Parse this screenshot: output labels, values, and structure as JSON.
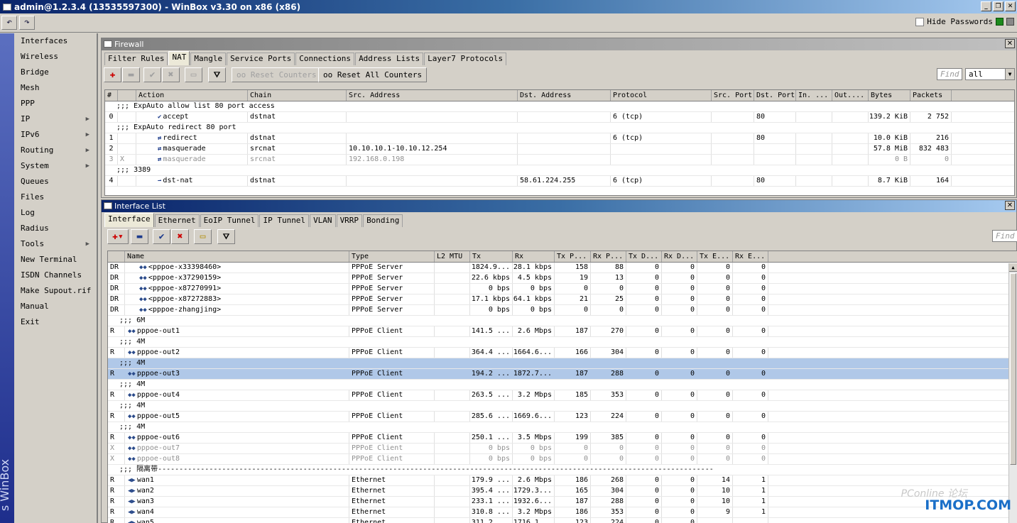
{
  "window": {
    "title": "admin@1.2.3.4 (13535597300) - WinBox v3.30 on x86 (x86)",
    "btns": [
      "_",
      "❐",
      "✕"
    ]
  },
  "toolbar": {
    "undo_icon": "undo-icon",
    "redo_icon": "redo-icon",
    "hide_passwords_label": "Hide Passwords"
  },
  "brand": "s WinBox",
  "menu": [
    {
      "label": "Interfaces",
      "sub": false
    },
    {
      "label": "Wireless",
      "sub": false
    },
    {
      "label": "Bridge",
      "sub": false
    },
    {
      "label": "Mesh",
      "sub": false
    },
    {
      "label": "PPP",
      "sub": false
    },
    {
      "label": "IP",
      "sub": true
    },
    {
      "label": "IPv6",
      "sub": true
    },
    {
      "label": "Routing",
      "sub": true
    },
    {
      "label": "System",
      "sub": true
    },
    {
      "label": "Queues",
      "sub": false
    },
    {
      "label": "Files",
      "sub": false
    },
    {
      "label": "Log",
      "sub": false
    },
    {
      "label": "Radius",
      "sub": false
    },
    {
      "label": "Tools",
      "sub": true
    },
    {
      "label": "New Terminal",
      "sub": false
    },
    {
      "label": "ISDN Channels",
      "sub": false
    },
    {
      "label": "Make Supout.rif",
      "sub": false
    },
    {
      "label": "Manual",
      "sub": false
    },
    {
      "label": "Exit",
      "sub": false
    }
  ],
  "firewall": {
    "title": "Firewall",
    "tabs": [
      "Filter Rules",
      "NAT",
      "Mangle",
      "Service Ports",
      "Connections",
      "Address Lists",
      "Layer7 Protocols"
    ],
    "selected_tab": "NAT",
    "reset_counters": "Reset Counters",
    "reset_all_counters": "Reset All Counters",
    "find_placeholder": "Find",
    "filter_value": "all",
    "columns": [
      "#",
      "",
      "Action",
      "Chain",
      "Src. Address",
      "Dst. Address",
      "Protocol",
      "Src. Port",
      "Dst. Port",
      "In. ...",
      "Out....",
      "Bytes",
      "Packets"
    ],
    "rows": [
      {
        "type": "comment",
        "text": ";;; ExpAuto allow list 80 port access"
      },
      {
        "type": "row",
        "num": "0",
        "flag": "",
        "icon": "✔",
        "action": "accept",
        "chain": "dstnat",
        "src": "",
        "dst": "",
        "proto": "6 (tcp)",
        "sport": "",
        "dport": "80",
        "in": "",
        "out": "",
        "bytes": "139.2 KiB",
        "packets": "2 752"
      },
      {
        "type": "comment",
        "text": ";;; ExpAuto redirect 80 port"
      },
      {
        "type": "row",
        "num": "1",
        "flag": "",
        "icon": "⇄",
        "action": "redirect",
        "chain": "dstnat",
        "src": "",
        "dst": "",
        "proto": "6 (tcp)",
        "sport": "",
        "dport": "80",
        "in": "",
        "out": "",
        "bytes": "10.0 KiB",
        "packets": "216"
      },
      {
        "type": "row",
        "num": "2",
        "flag": "",
        "icon": "⇄",
        "action": "masquerade",
        "chain": "srcnat",
        "src": "10.10.10.1-10.10.12.254",
        "dst": "",
        "proto": "",
        "sport": "",
        "dport": "",
        "in": "",
        "out": "",
        "bytes": "57.8 MiB",
        "packets": "832 483"
      },
      {
        "type": "row",
        "disabled": true,
        "num": "3",
        "flag": "X",
        "icon": "⇄",
        "action": "masquerade",
        "chain": "srcnat",
        "src": "192.168.0.198",
        "dst": "",
        "proto": "",
        "sport": "",
        "dport": "",
        "in": "",
        "out": "",
        "bytes": "0 B",
        "packets": "0"
      },
      {
        "type": "comment",
        "text": ";;; 3389"
      },
      {
        "type": "row",
        "num": "4",
        "flag": "",
        "icon": "⇀",
        "action": "dst-nat",
        "chain": "dstnat",
        "src": "",
        "dst": "58.61.224.255",
        "proto": "6 (tcp)",
        "sport": "",
        "dport": "80",
        "in": "",
        "out": "",
        "bytes": "8.7 KiB",
        "packets": "164"
      }
    ]
  },
  "interfaces": {
    "title": "Interface List",
    "tabs": [
      "Interface",
      "Ethernet",
      "EoIP Tunnel",
      "IP Tunnel",
      "VLAN",
      "VRRP",
      "Bonding"
    ],
    "selected_tab": "Interface",
    "find_placeholder": "Find",
    "columns": [
      "",
      "Name",
      "Type",
      "L2 MTU",
      "Tx",
      "Rx",
      "Tx P...",
      "Rx P...",
      "Tx D...",
      "Rx D...",
      "Tx E...",
      "Rx E..."
    ],
    "rows": [
      {
        "type": "row",
        "flag": "DR",
        "name": "<pppoe-x33398460>",
        "itype": "PPPoE Server",
        "mtu": "",
        "tx": "1824.9...",
        "rx": "28.1 kbps",
        "txp": "158",
        "rxp": "88",
        "txd": "0",
        "rxd": "0",
        "txe": "0",
        "rxe": "0",
        "indent": true
      },
      {
        "type": "row",
        "flag": "DR",
        "name": "<pppoe-x37290159>",
        "itype": "PPPoE Server",
        "mtu": "",
        "tx": "22.6 kbps",
        "rx": "4.5 kbps",
        "txp": "19",
        "rxp": "13",
        "txd": "0",
        "rxd": "0",
        "txe": "0",
        "rxe": "0",
        "indent": true
      },
      {
        "type": "row",
        "flag": "DR",
        "name": "<pppoe-x87270991>",
        "itype": "PPPoE Server",
        "mtu": "",
        "tx": "0 bps",
        "rx": "0 bps",
        "txp": "0",
        "rxp": "0",
        "txd": "0",
        "rxd": "0",
        "txe": "0",
        "rxe": "0",
        "indent": true
      },
      {
        "type": "row",
        "flag": "DR",
        "name": "<pppoe-x87272883>",
        "itype": "PPPoE Server",
        "mtu": "",
        "tx": "17.1 kbps",
        "rx": "64.1 kbps",
        "txp": "21",
        "rxp": "25",
        "txd": "0",
        "rxd": "0",
        "txe": "0",
        "rxe": "0",
        "indent": true
      },
      {
        "type": "row",
        "flag": "DR",
        "name": "<pppoe-zhangjing>",
        "itype": "PPPoE Server",
        "mtu": "",
        "tx": "0 bps",
        "rx": "0 bps",
        "txp": "0",
        "rxp": "0",
        "txd": "0",
        "rxd": "0",
        "txe": "0",
        "rxe": "0",
        "indent": true
      },
      {
        "type": "comment",
        "text": ";;; 6M"
      },
      {
        "type": "row",
        "flag": "R",
        "name": "pppoe-out1",
        "itype": "PPPoE Client",
        "mtu": "",
        "tx": "141.5 ...",
        "rx": "2.6 Mbps",
        "txp": "187",
        "rxp": "270",
        "txd": "0",
        "rxd": "0",
        "txe": "0",
        "rxe": "0"
      },
      {
        "type": "comment",
        "text": ";;; 4M"
      },
      {
        "type": "row",
        "flag": "R",
        "name": "pppoe-out2",
        "itype": "PPPoE Client",
        "mtu": "",
        "tx": "364.4 ...",
        "rx": "1664.6...",
        "txp": "166",
        "rxp": "304",
        "txd": "0",
        "rxd": "0",
        "txe": "0",
        "rxe": "0"
      },
      {
        "type": "comment",
        "selected": true,
        "text": ";;; 4M"
      },
      {
        "type": "row",
        "selected": true,
        "flag": "R",
        "name": "pppoe-out3",
        "itype": "PPPoE Client",
        "mtu": "",
        "tx": "194.2 ...",
        "rx": "1872.7...",
        "txp": "187",
        "rxp": "288",
        "txd": "0",
        "rxd": "0",
        "txe": "0",
        "rxe": "0"
      },
      {
        "type": "comment",
        "text": ";;; 4M"
      },
      {
        "type": "row",
        "flag": "R",
        "name": "pppoe-out4",
        "itype": "PPPoE Client",
        "mtu": "",
        "tx": "263.5 ...",
        "rx": "3.2 Mbps",
        "txp": "185",
        "rxp": "353",
        "txd": "0",
        "rxd": "0",
        "txe": "0",
        "rxe": "0"
      },
      {
        "type": "comment",
        "text": ";;; 4M"
      },
      {
        "type": "row",
        "flag": "R",
        "name": "pppoe-out5",
        "itype": "PPPoE Client",
        "mtu": "",
        "tx": "285.6 ...",
        "rx": "1669.6...",
        "txp": "123",
        "rxp": "224",
        "txd": "0",
        "rxd": "0",
        "txe": "0",
        "rxe": "0"
      },
      {
        "type": "comment",
        "text": ";;; 4M"
      },
      {
        "type": "row",
        "flag": "R",
        "name": "pppoe-out6",
        "itype": "PPPoE Client",
        "mtu": "",
        "tx": "250.1 ...",
        "rx": "3.5 Mbps",
        "txp": "199",
        "rxp": "385",
        "txd": "0",
        "rxd": "0",
        "txe": "0",
        "rxe": "0"
      },
      {
        "type": "row",
        "disabled": true,
        "flag": "X",
        "name": "pppoe-out7",
        "itype": "PPPoE Client",
        "mtu": "",
        "tx": "0 bps",
        "rx": "0 bps",
        "txp": "0",
        "rxp": "0",
        "txd": "0",
        "rxd": "0",
        "txe": "0",
        "rxe": "0"
      },
      {
        "type": "row",
        "disabled": true,
        "flag": "X",
        "name": "pppoe-out8",
        "itype": "PPPoE Client",
        "mtu": "",
        "tx": "0 bps",
        "rx": "0 bps",
        "txp": "0",
        "rxp": "0",
        "txd": "0",
        "rxd": "0",
        "txe": "0",
        "rxe": "0"
      },
      {
        "type": "comment",
        "text": ";;; 隔离带----------------------------------------------------------------------------------------------------------------------------------"
      },
      {
        "type": "row",
        "flag": "R",
        "name": "wan1",
        "itype": "Ethernet",
        "mtu": "",
        "tx": "179.9 ...",
        "rx": "2.6 Mbps",
        "txp": "186",
        "rxp": "268",
        "txd": "0",
        "rxd": "0",
        "txe": "14",
        "rxe": "1",
        "eth": true
      },
      {
        "type": "row",
        "flag": "R",
        "name": "wan2",
        "itype": "Ethernet",
        "mtu": "",
        "tx": "395.4 ...",
        "rx": "1729.3...",
        "txp": "165",
        "rxp": "304",
        "txd": "0",
        "rxd": "0",
        "txe": "10",
        "rxe": "1",
        "eth": true
      },
      {
        "type": "row",
        "flag": "R",
        "name": "wan3",
        "itype": "Ethernet",
        "mtu": "",
        "tx": "233.1 ...",
        "rx": "1932.6...",
        "txp": "187",
        "rxp": "288",
        "txd": "0",
        "rxd": "0",
        "txe": "10",
        "rxe": "1",
        "eth": true
      },
      {
        "type": "row",
        "flag": "R",
        "name": "wan4",
        "itype": "Ethernet",
        "mtu": "",
        "tx": "310.8 ...",
        "rx": "3.2 Mbps",
        "txp": "186",
        "rxp": "353",
        "txd": "0",
        "rxd": "0",
        "txe": "9",
        "rxe": "1",
        "eth": true
      },
      {
        "type": "row",
        "flag": "R",
        "name": "wan5",
        "itype": "Ethernet",
        "mtu": "",
        "tx": "311.2 ...",
        "rx": "1716.1...",
        "txp": "123",
        "rxp": "224",
        "txd": "0",
        "rxd": "0",
        "txe": "",
        "rxe": "",
        "eth": true
      }
    ]
  },
  "watermark": {
    "main": "ITMOP.COM",
    "faint": "PConline 论坛"
  }
}
